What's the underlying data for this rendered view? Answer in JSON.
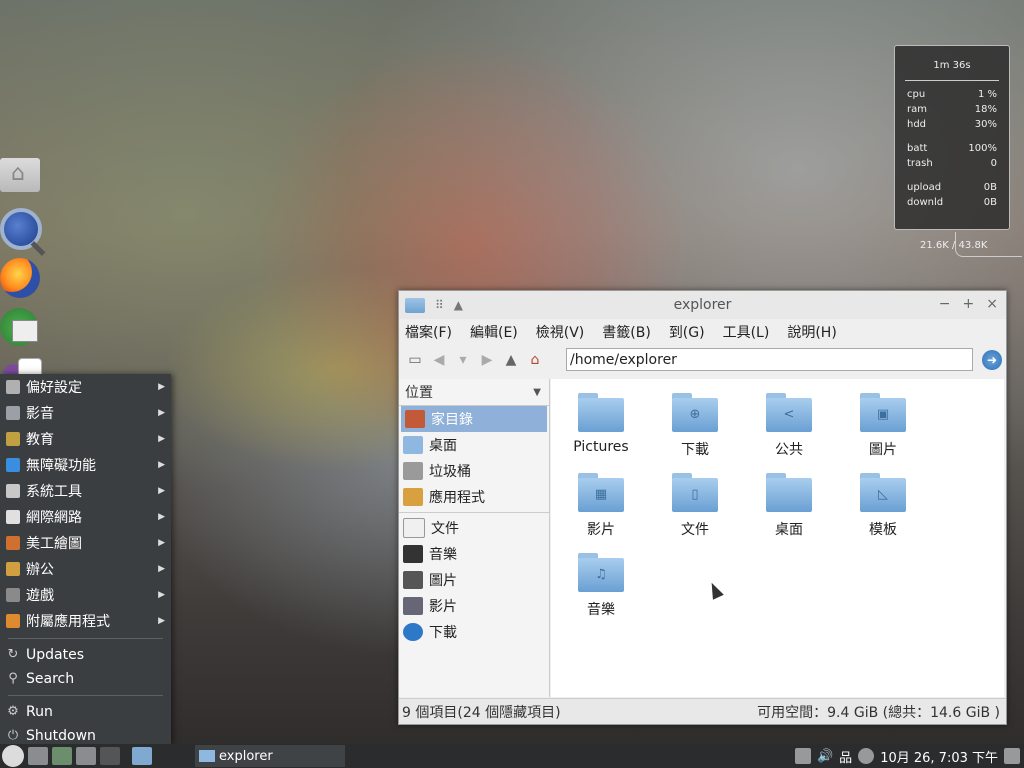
{
  "dock": {
    "items": [
      "home-folder-icon",
      "search-icon",
      "firefox-icon",
      "notes-icon",
      "pidgin-icon"
    ]
  },
  "start_menu": {
    "categories": [
      {
        "label": "偏好設定",
        "icon": "preferences-icon",
        "color": "#b0b0b0"
      },
      {
        "label": "影音",
        "icon": "multimedia-icon",
        "color": "#9aa0a6"
      },
      {
        "label": "教育",
        "icon": "education-icon",
        "color": "#c0a040"
      },
      {
        "label": "無障礙功能",
        "icon": "accessibility-icon",
        "color": "#3a8ee0"
      },
      {
        "label": "系統工具",
        "icon": "gear-icon",
        "color": "#c8c8c8"
      },
      {
        "label": "網際網路",
        "icon": "cloud-icon",
        "color": "#e0e0e0"
      },
      {
        "label": "美工繪圖",
        "icon": "graphics-icon",
        "color": "#d07030"
      },
      {
        "label": "辦公",
        "icon": "office-icon",
        "color": "#d0a040"
      },
      {
        "label": "遊戲",
        "icon": "games-icon",
        "color": "#8a8a8a"
      },
      {
        "label": "附屬應用程式",
        "icon": "accessories-icon",
        "color": "#e08a30"
      }
    ],
    "actions": [
      {
        "label": "Updates",
        "icon": "refresh-icon",
        "glyph": "↻"
      },
      {
        "label": "Search",
        "icon": "search-icon",
        "glyph": "⚲"
      },
      {
        "label": "Run",
        "icon": "run-icon",
        "glyph": "⚙"
      },
      {
        "label": "Shutdown",
        "icon": "power-icon",
        "glyph": "⏻"
      }
    ]
  },
  "conky": {
    "uptime": "1m 36s",
    "rows1": [
      {
        "k": "cpu",
        "v": "1 %"
      },
      {
        "k": "ram",
        "v": "18%"
      },
      {
        "k": "hdd",
        "v": "30%"
      }
    ],
    "rows2": [
      {
        "k": "batt",
        "v": "100%"
      },
      {
        "k": "trash",
        "v": "0"
      }
    ],
    "rows3": [
      {
        "k": "upload",
        "v": "0B"
      },
      {
        "k": "downld",
        "v": "0B"
      }
    ],
    "net_total": "21.6K / 43.8K"
  },
  "window": {
    "title": "explorer",
    "menu": [
      "檔案(F)",
      "編輯(E)",
      "檢視(V)",
      "書籤(B)",
      "到(G)",
      "工具(L)",
      "說明(H)"
    ],
    "path": "/home/explorer",
    "sidebar_header": "位置",
    "places": [
      {
        "label": "家目錄",
        "icon": "home-icon",
        "selected": true
      },
      {
        "label": "桌面",
        "icon": "desktop-icon"
      },
      {
        "label": "垃圾桶",
        "icon": "trash-icon"
      },
      {
        "label": "應用程式",
        "icon": "applications-icon"
      }
    ],
    "bookmarks": [
      {
        "label": "文件",
        "icon": "document-icon"
      },
      {
        "label": "音樂",
        "icon": "music-icon"
      },
      {
        "label": "圖片",
        "icon": "picture-icon"
      },
      {
        "label": "影片",
        "icon": "video-icon"
      },
      {
        "label": "下載",
        "icon": "download-icon"
      }
    ],
    "files": [
      {
        "label": "Pictures",
        "glyph": ""
      },
      {
        "label": "下載",
        "glyph": "⊕"
      },
      {
        "label": "公共",
        "glyph": "<"
      },
      {
        "label": "圖片",
        "glyph": "▣"
      },
      {
        "label": "影片",
        "glyph": "▦"
      },
      {
        "label": "文件",
        "glyph": "▯"
      },
      {
        "label": "桌面",
        "glyph": ""
      },
      {
        "label": "模板",
        "glyph": "◺"
      },
      {
        "label": "音樂",
        "glyph": "♫"
      }
    ],
    "status_left": "9 個項目(24 個隱藏項目)",
    "status_right": "可用空間：9.4 GiB (總共：14.6 GiB )"
  },
  "taskbar": {
    "task_label": "explorer",
    "clock": "10月 26,  7:03 下午"
  }
}
